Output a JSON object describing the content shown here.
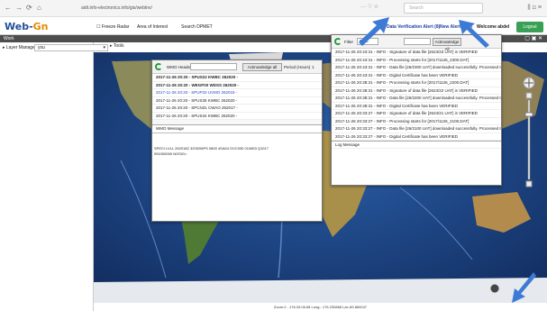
{
  "browser": {
    "nav_icons": [
      "←",
      "→",
      "⟳",
      "⌂"
    ],
    "url": "aidt.info-electronics.info/gis/webtnv/",
    "url_icons": "··· ♡ ☆",
    "search_placeholder": "Search",
    "right_icons": "⫼ ⊡ ≡"
  },
  "app": {
    "logo_main": "Web-",
    "logo_accent": "Gn",
    "menu": [
      "Freeze Radar",
      "Area of Interest",
      "Search DPMET"
    ],
    "alert_verification": "Data Verification Alert (8)",
    "alert_new": "New Alert (141)",
    "welcome": "Welcome abdel",
    "logout": "Logout"
  },
  "workbar": {
    "label": "Work",
    "right_icons": "▢ ▣ ✕"
  },
  "leftpanel": {
    "title": "Layer Manager",
    "select_value": "ysu",
    "tools_label": "Tools"
  },
  "wmo_window": {
    "title": "WMO Header",
    "ack_label": "Acknowledge all",
    "period_label": "Period (Hours)",
    "period_value": "1",
    "rows": [
      {
        "text": "2017-11-26 20:20 - SPUS22 KWBC 262020 -",
        "style": "bold"
      },
      {
        "text": "2017-11-26 20:20 - WEGP20 WDSS 262020 -",
        "style": "bold"
      },
      {
        "text": "2017-11-26 20:20 - SPUP20 UVMO 262018 -",
        "style": "blue"
      },
      {
        "text": "2017-11-26 20:20 - SPUS35 KWBC 262020 -",
        "style": "normal"
      },
      {
        "text": "2017-11-26 20:20 - SPCN31 CWAO 262017 -",
        "style": "normal"
      },
      {
        "text": "2017-11-26 20:20 - SPUS34 KWBC 262020 -",
        "style": "normal"
      }
    ],
    "message_label": "WMO Message",
    "message_text": "SPECI LVLL 262018Z 32002MPS 0800 4SA04 OVC030 01/M03 Q1017",
    "message_text2": "051000000 NOSIG="
  },
  "log_window": {
    "filter_label": "Filter",
    "filter_value": "EOC",
    "ack_label": "Acknowledge All",
    "rows": [
      "2017-11-26 20:43:31 - INFO - Signature of data file [2623/23 UAT] is VERIFIED",
      "2017-11-26 20:43:31 - INFO - Processing starts for [2017/1126_2300.DAT]",
      "2017-11-26 20:43:31 - INFO - Data file [26/2300 UAT] downloaded successfully. Processed to...",
      "2017-11-26 20:43:31 - INFO - Digital Certificate has been VERIFIED",
      "2017-11-26 20:38:31 - INFO - Processing starts for [2017/1126_2200.DAT]",
      "2017-11-26 20:38:31 - INFO - Signature of data file [2623/22 UAT] is VERIFIED",
      "2017-11-26 20:38:31 - INFO - Data file [26/2200 UAT] downloaded successfully. Processed to...",
      "2017-11-26 20:38:31 - INFO - Digital Certificate has been VERIFIED",
      "2017-11-26 20:33:27 - INFO - Signature of data file [2623/21 UAT] is VERIFIED",
      "2017-11-26 20:33:27 - INFO - Processing starts for [2017/1126_2100.DAT]",
      "2017-11-26 20:33:27 - INFO - Data file [26/2100 UAT] downloaded successfully. Processed to...",
      "2017-11-26 20:33:27 - INFO - Digital Certificate has been VERIFIED"
    ],
    "log_label": "Log Message"
  },
  "footer": {
    "text": "Zoom:2 - 176.33.06.68 Long:- 176.230868 Lat:-89.860047"
  },
  "colors": {
    "accent_green": "#3aa055",
    "link_blue": "#1f3fa0",
    "arrow_blue": "#3c7ad6",
    "dark_bar": "#4d4d4d"
  }
}
